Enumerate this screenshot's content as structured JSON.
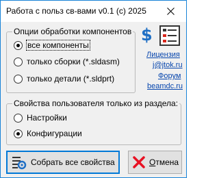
{
  "window": {
    "title": "Работа с польз св-вами v0.1 (c) 2025"
  },
  "component_options": {
    "legend": "Опции обработки компонентов",
    "options": [
      {
        "label": "все компоненты",
        "selected": true
      },
      {
        "label": "только сборки (*.sldasm)",
        "selected": false
      },
      {
        "label": "только детали (*.sldprt)",
        "selected": false
      }
    ]
  },
  "properties_section": {
    "legend": "Свойства пользователя только из раздела:",
    "options": [
      {
        "label": "Настройки",
        "selected": false
      },
      {
        "label": "Конфигурации",
        "selected": true
      }
    ]
  },
  "side_links": {
    "dollar_symbol": "$",
    "license": "Лицензия",
    "email": "j@jtok.ru",
    "forum": "Форум",
    "site": "beamdc.ru"
  },
  "buttons": {
    "collect_all": "Собрать все свойства",
    "cancel_underlined": "О",
    "cancel_rest": "тмена"
  },
  "colors": {
    "accent": "#0078d7",
    "link": "#0645ad",
    "cancel_x": "#e81123",
    "dollar": "#1f6fc5"
  }
}
